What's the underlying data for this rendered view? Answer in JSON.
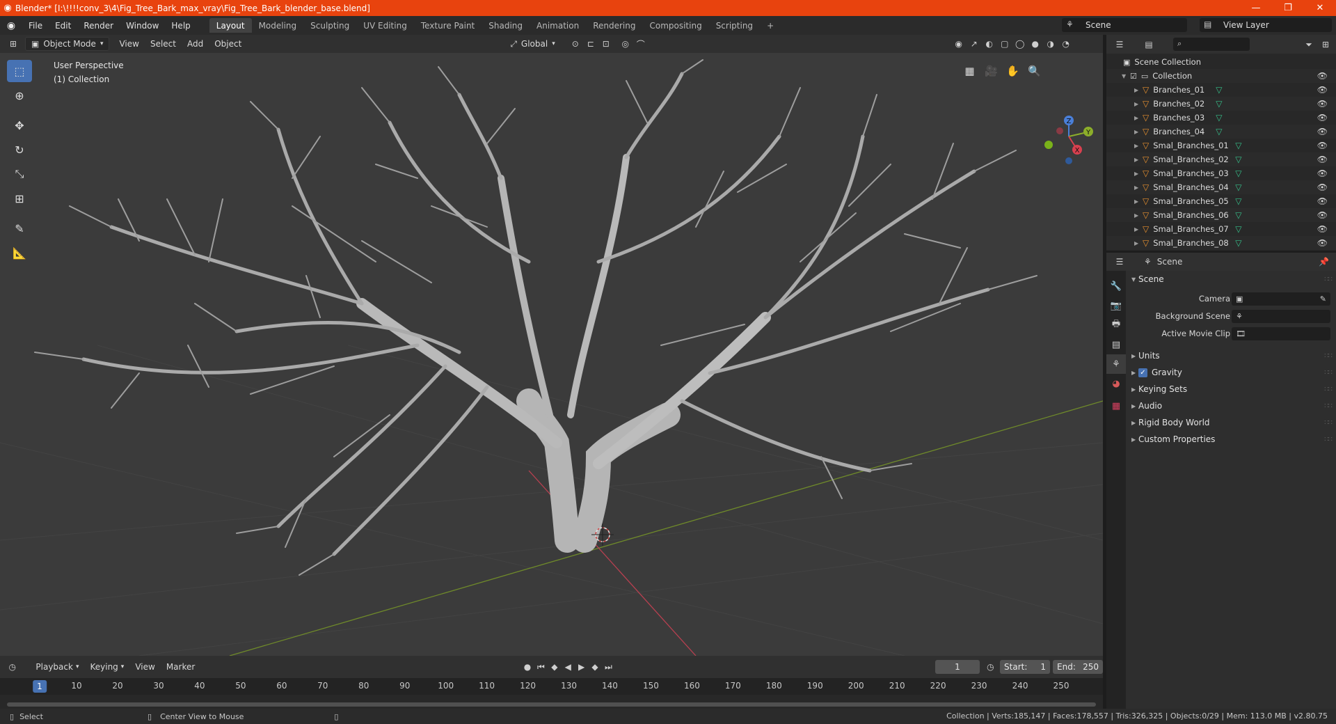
{
  "window": {
    "title": "Blender* [I:\\!!!!conv_3\\4\\Fig_Tree_Bark_max_vray\\Fig_Tree_Bark_blender_base.blend]",
    "minimize": "—",
    "maximize": "❐",
    "close": "✕"
  },
  "menu": [
    "File",
    "Edit",
    "Render",
    "Window",
    "Help"
  ],
  "workspaces": [
    {
      "label": "Layout",
      "active": true
    },
    {
      "label": "Modeling"
    },
    {
      "label": "Sculpting"
    },
    {
      "label": "UV Editing"
    },
    {
      "label": "Texture Paint"
    },
    {
      "label": "Shading"
    },
    {
      "label": "Animation"
    },
    {
      "label": "Rendering"
    },
    {
      "label": "Compositing"
    },
    {
      "label": "Scripting"
    }
  ],
  "add_workspace": "+",
  "scene_selector": "Scene",
  "view_layer": "View Layer",
  "viewport_header": {
    "mode": "Object Mode",
    "menus": [
      "View",
      "Select",
      "Add",
      "Object"
    ],
    "orientation": "Global"
  },
  "viewport": {
    "perspective": "User Perspective",
    "collection": "(1) Collection",
    "gizmo": {
      "x": "X",
      "y": "Y",
      "z": "Z"
    }
  },
  "outliner": {
    "root": "Scene Collection",
    "collection": "Collection",
    "items": [
      "Branches_01",
      "Branches_02",
      "Branches_03",
      "Branches_04",
      "Smal_Branches_01",
      "Smal_Branches_02",
      "Smal_Branches_03",
      "Smal_Branches_04",
      "Smal_Branches_05",
      "Smal_Branches_06",
      "Smal_Branches_07",
      "Smal_Branches_08"
    ]
  },
  "properties": {
    "context": "Scene",
    "panel_title": "Scene",
    "fields": [
      {
        "label": "Camera"
      },
      {
        "label": "Background Scene"
      },
      {
        "label": "Active Movie Clip"
      }
    ],
    "panels": [
      "Units",
      "Gravity",
      "Keying Sets",
      "Audio",
      "Rigid Body World",
      "Custom Properties"
    ],
    "gravity_checked": true
  },
  "timeline": {
    "menus": [
      "Playback",
      "Keying",
      "View",
      "Marker"
    ],
    "current_frame": "1",
    "start_label": "Start:",
    "start": "1",
    "end_label": "End:",
    "end": "250",
    "ticks": [
      "1",
      "10",
      "20",
      "30",
      "40",
      "50",
      "60",
      "70",
      "80",
      "90",
      "100",
      "110",
      "120",
      "130",
      "140",
      "150",
      "160",
      "170",
      "180",
      "190",
      "200",
      "210",
      "220",
      "230",
      "240",
      "250"
    ]
  },
  "statusbar": {
    "left": "Select",
    "middle": "Center View to Mouse",
    "right": "Collection | Verts:185,147 | Faces:178,557 | Tris:326,325 | Objects:0/29 | Mem: 113.0 MB | v2.80.75"
  }
}
